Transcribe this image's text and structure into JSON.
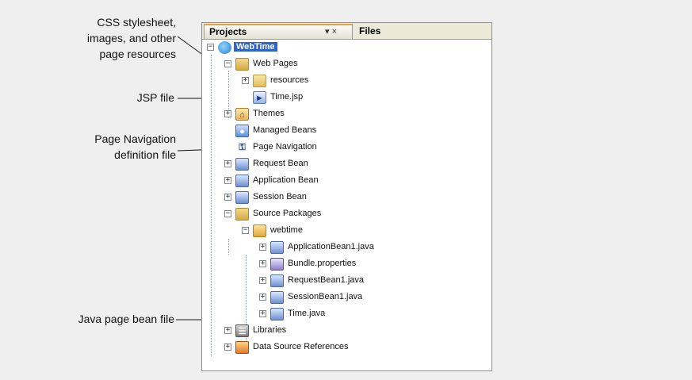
{
  "callouts": {
    "css": [
      "CSS stylesheet,",
      "images, and other",
      "page resources"
    ],
    "jsp": "JSP file",
    "nav": [
      "Page Navigation",
      "definition file"
    ],
    "bean": "Java page bean file"
  },
  "panel": {
    "tab_projects": "Projects",
    "tab_controls": "▾ ×",
    "tab_files": "Files"
  },
  "tree": {
    "root": "WebTime",
    "web_pages": "Web Pages",
    "resources": "resources",
    "time_jsp": "Time.jsp",
    "themes": "Themes",
    "managed_beans": "Managed Beans",
    "page_navigation": "Page Navigation",
    "request_bean": "Request Bean",
    "application_bean": "Application Bean",
    "session_bean": "Session Bean",
    "source_packages": "Source Packages",
    "webtime_pkg": "webtime",
    "app_bean_java": "ApplicationBean1.java",
    "bundle_props": "Bundle.properties",
    "request_bean_java": "RequestBean1.java",
    "session_bean_java": "SessionBean1.java",
    "time_java": "Time.java",
    "libraries": "Libraries",
    "data_sources": "Data Source References"
  },
  "expanders": {
    "collapsed": "+",
    "expanded": "−"
  },
  "colors": {
    "selection": "#2f63c8",
    "tab_accent": "#e8a23a",
    "background": "#efefef"
  }
}
